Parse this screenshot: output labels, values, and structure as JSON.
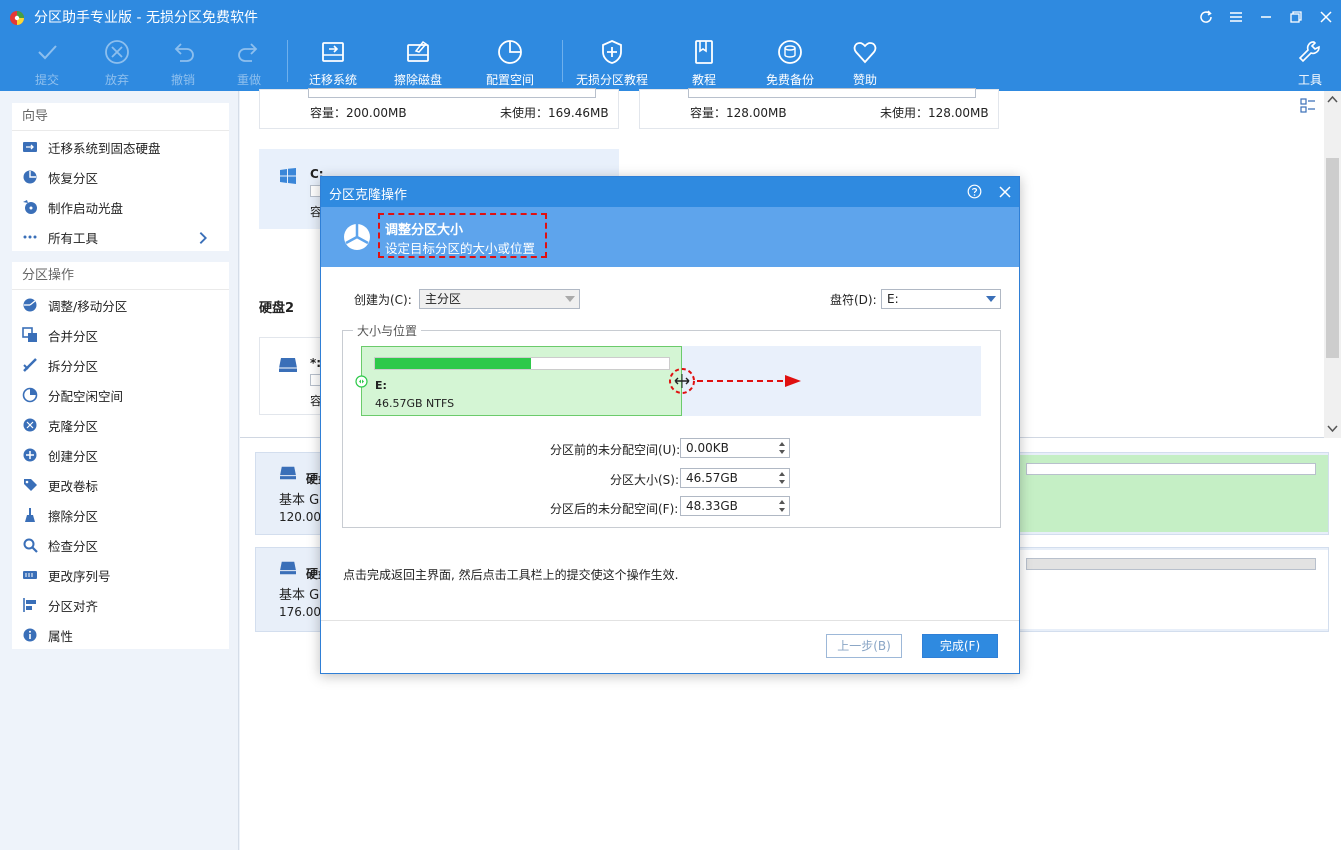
{
  "app": {
    "title": "分区助手专业版 - 无损分区免费软件"
  },
  "toolbar": {
    "items": [
      {
        "label": "提交",
        "icon": "check-icon",
        "enabled": false
      },
      {
        "label": "放弃",
        "icon": "cancel-circle-icon",
        "enabled": false
      },
      {
        "label": "撤销",
        "icon": "undo-icon",
        "enabled": false
      },
      {
        "label": "重做",
        "icon": "redo-icon",
        "enabled": false
      },
      {
        "label": "迁移系统",
        "icon": "migrate-os-icon",
        "enabled": true
      },
      {
        "label": "擦除磁盘",
        "icon": "wipe-disk-icon",
        "enabled": true
      },
      {
        "label": "配置空间",
        "icon": "allocate-space-icon",
        "enabled": true
      },
      {
        "label": "无损分区教程",
        "icon": "shield-icon",
        "enabled": true
      },
      {
        "label": "教程",
        "icon": "book-icon",
        "enabled": true
      },
      {
        "label": "免费备份",
        "icon": "backup-icon",
        "enabled": true
      },
      {
        "label": "赞助",
        "icon": "heart-icon",
        "enabled": true
      }
    ],
    "tools_label": "工具"
  },
  "sidebar": {
    "wizard_title": "向导",
    "wizard_items": [
      "迁移系统到固态硬盘",
      "恢复分区",
      "制作启动光盘",
      "所有工具"
    ],
    "ops_title": "分区操作",
    "ops_items": [
      "调整/移动分区",
      "合并分区",
      "拆分分区",
      "分配空闲空间",
      "克隆分区",
      "创建分区",
      "更改卷标",
      "擦除分区",
      "检查分区",
      "更改序列号",
      "分区对齐",
      "属性"
    ]
  },
  "main": {
    "card1_capacity": "容量：200.00MB",
    "card1_free": "未使用：169.46MB",
    "card2_capacity": "容量：128.00MB",
    "card2_free": "未使用：128.00MB",
    "c_label": "C:",
    "c_capacity_partial": "容",
    "disk2_title": "硬盘2",
    "disk2_part_label": "*:",
    "disk2_part_capacity_partial": "容",
    "disk_panel1_name": "硬盘",
    "disk_panel1_type": "基本 G",
    "disk_panel1_size": "120.00(",
    "disk_panel2_name": "硬盘",
    "disk_panel2_type": "基本 G",
    "disk_panel2_size": "176.00("
  },
  "dialog": {
    "title": "分区克隆操作",
    "banner_title": "调整分区大小",
    "banner_subtitle": "设定目标分区的大小或位置",
    "create_as_label": "创建为(C):",
    "create_as_value": "主分区",
    "drive_letter_label": "盘符(D):",
    "drive_letter_value": "E:",
    "group_title": "大小与位置",
    "partition_name": "E:",
    "partition_info": "46.57GB NTFS",
    "partition_used_fraction": 0.53,
    "before_label": "分区前的未分配空间(U):",
    "before_value": "0.00KB",
    "size_label": "分区大小(S):",
    "size_value": "46.57GB",
    "after_label": "分区后的未分配空间(F):",
    "after_value": "48.33GB",
    "hint": "点击完成返回主界面, 然后点击工具栏上的提交使这个操作生效.",
    "prev_button": "上一步(B)",
    "finish_button": "完成(F)"
  },
  "colors": {
    "accent": "#2f8ae0",
    "banner": "#5ea4ec",
    "partition_fill": "#d4f5d4",
    "used_bar": "#2ec94a",
    "annotation": "#e01010"
  }
}
